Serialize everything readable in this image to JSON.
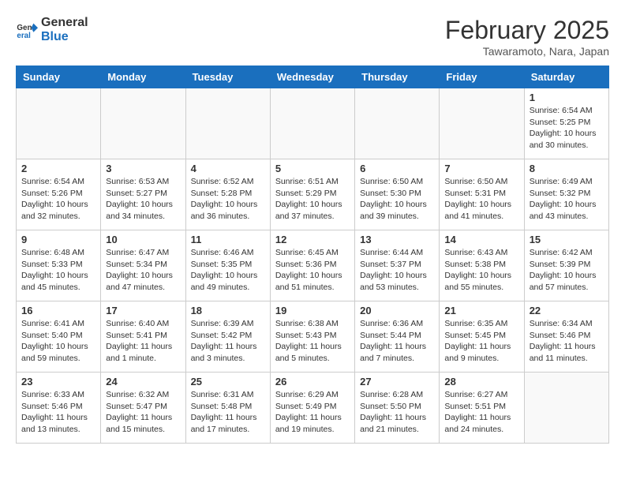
{
  "header": {
    "logo_line1": "General",
    "logo_line2": "Blue",
    "month_title": "February 2025",
    "location": "Tawaramoto, Nara, Japan"
  },
  "weekdays": [
    "Sunday",
    "Monday",
    "Tuesday",
    "Wednesday",
    "Thursday",
    "Friday",
    "Saturday"
  ],
  "weeks": [
    [
      {
        "day": "",
        "info": ""
      },
      {
        "day": "",
        "info": ""
      },
      {
        "day": "",
        "info": ""
      },
      {
        "day": "",
        "info": ""
      },
      {
        "day": "",
        "info": ""
      },
      {
        "day": "",
        "info": ""
      },
      {
        "day": "1",
        "info": "Sunrise: 6:54 AM\nSunset: 5:25 PM\nDaylight: 10 hours and 30 minutes."
      }
    ],
    [
      {
        "day": "2",
        "info": "Sunrise: 6:54 AM\nSunset: 5:26 PM\nDaylight: 10 hours and 32 minutes."
      },
      {
        "day": "3",
        "info": "Sunrise: 6:53 AM\nSunset: 5:27 PM\nDaylight: 10 hours and 34 minutes."
      },
      {
        "day": "4",
        "info": "Sunrise: 6:52 AM\nSunset: 5:28 PM\nDaylight: 10 hours and 36 minutes."
      },
      {
        "day": "5",
        "info": "Sunrise: 6:51 AM\nSunset: 5:29 PM\nDaylight: 10 hours and 37 minutes."
      },
      {
        "day": "6",
        "info": "Sunrise: 6:50 AM\nSunset: 5:30 PM\nDaylight: 10 hours and 39 minutes."
      },
      {
        "day": "7",
        "info": "Sunrise: 6:50 AM\nSunset: 5:31 PM\nDaylight: 10 hours and 41 minutes."
      },
      {
        "day": "8",
        "info": "Sunrise: 6:49 AM\nSunset: 5:32 PM\nDaylight: 10 hours and 43 minutes."
      }
    ],
    [
      {
        "day": "9",
        "info": "Sunrise: 6:48 AM\nSunset: 5:33 PM\nDaylight: 10 hours and 45 minutes."
      },
      {
        "day": "10",
        "info": "Sunrise: 6:47 AM\nSunset: 5:34 PM\nDaylight: 10 hours and 47 minutes."
      },
      {
        "day": "11",
        "info": "Sunrise: 6:46 AM\nSunset: 5:35 PM\nDaylight: 10 hours and 49 minutes."
      },
      {
        "day": "12",
        "info": "Sunrise: 6:45 AM\nSunset: 5:36 PM\nDaylight: 10 hours and 51 minutes."
      },
      {
        "day": "13",
        "info": "Sunrise: 6:44 AM\nSunset: 5:37 PM\nDaylight: 10 hours and 53 minutes."
      },
      {
        "day": "14",
        "info": "Sunrise: 6:43 AM\nSunset: 5:38 PM\nDaylight: 10 hours and 55 minutes."
      },
      {
        "day": "15",
        "info": "Sunrise: 6:42 AM\nSunset: 5:39 PM\nDaylight: 10 hours and 57 minutes."
      }
    ],
    [
      {
        "day": "16",
        "info": "Sunrise: 6:41 AM\nSunset: 5:40 PM\nDaylight: 10 hours and 59 minutes."
      },
      {
        "day": "17",
        "info": "Sunrise: 6:40 AM\nSunset: 5:41 PM\nDaylight: 11 hours and 1 minute."
      },
      {
        "day": "18",
        "info": "Sunrise: 6:39 AM\nSunset: 5:42 PM\nDaylight: 11 hours and 3 minutes."
      },
      {
        "day": "19",
        "info": "Sunrise: 6:38 AM\nSunset: 5:43 PM\nDaylight: 11 hours and 5 minutes."
      },
      {
        "day": "20",
        "info": "Sunrise: 6:36 AM\nSunset: 5:44 PM\nDaylight: 11 hours and 7 minutes."
      },
      {
        "day": "21",
        "info": "Sunrise: 6:35 AM\nSunset: 5:45 PM\nDaylight: 11 hours and 9 minutes."
      },
      {
        "day": "22",
        "info": "Sunrise: 6:34 AM\nSunset: 5:46 PM\nDaylight: 11 hours and 11 minutes."
      }
    ],
    [
      {
        "day": "23",
        "info": "Sunrise: 6:33 AM\nSunset: 5:46 PM\nDaylight: 11 hours and 13 minutes."
      },
      {
        "day": "24",
        "info": "Sunrise: 6:32 AM\nSunset: 5:47 PM\nDaylight: 11 hours and 15 minutes."
      },
      {
        "day": "25",
        "info": "Sunrise: 6:31 AM\nSunset: 5:48 PM\nDaylight: 11 hours and 17 minutes."
      },
      {
        "day": "26",
        "info": "Sunrise: 6:29 AM\nSunset: 5:49 PM\nDaylight: 11 hours and 19 minutes."
      },
      {
        "day": "27",
        "info": "Sunrise: 6:28 AM\nSunset: 5:50 PM\nDaylight: 11 hours and 21 minutes."
      },
      {
        "day": "28",
        "info": "Sunrise: 6:27 AM\nSunset: 5:51 PM\nDaylight: 11 hours and 24 minutes."
      },
      {
        "day": "",
        "info": ""
      }
    ]
  ]
}
